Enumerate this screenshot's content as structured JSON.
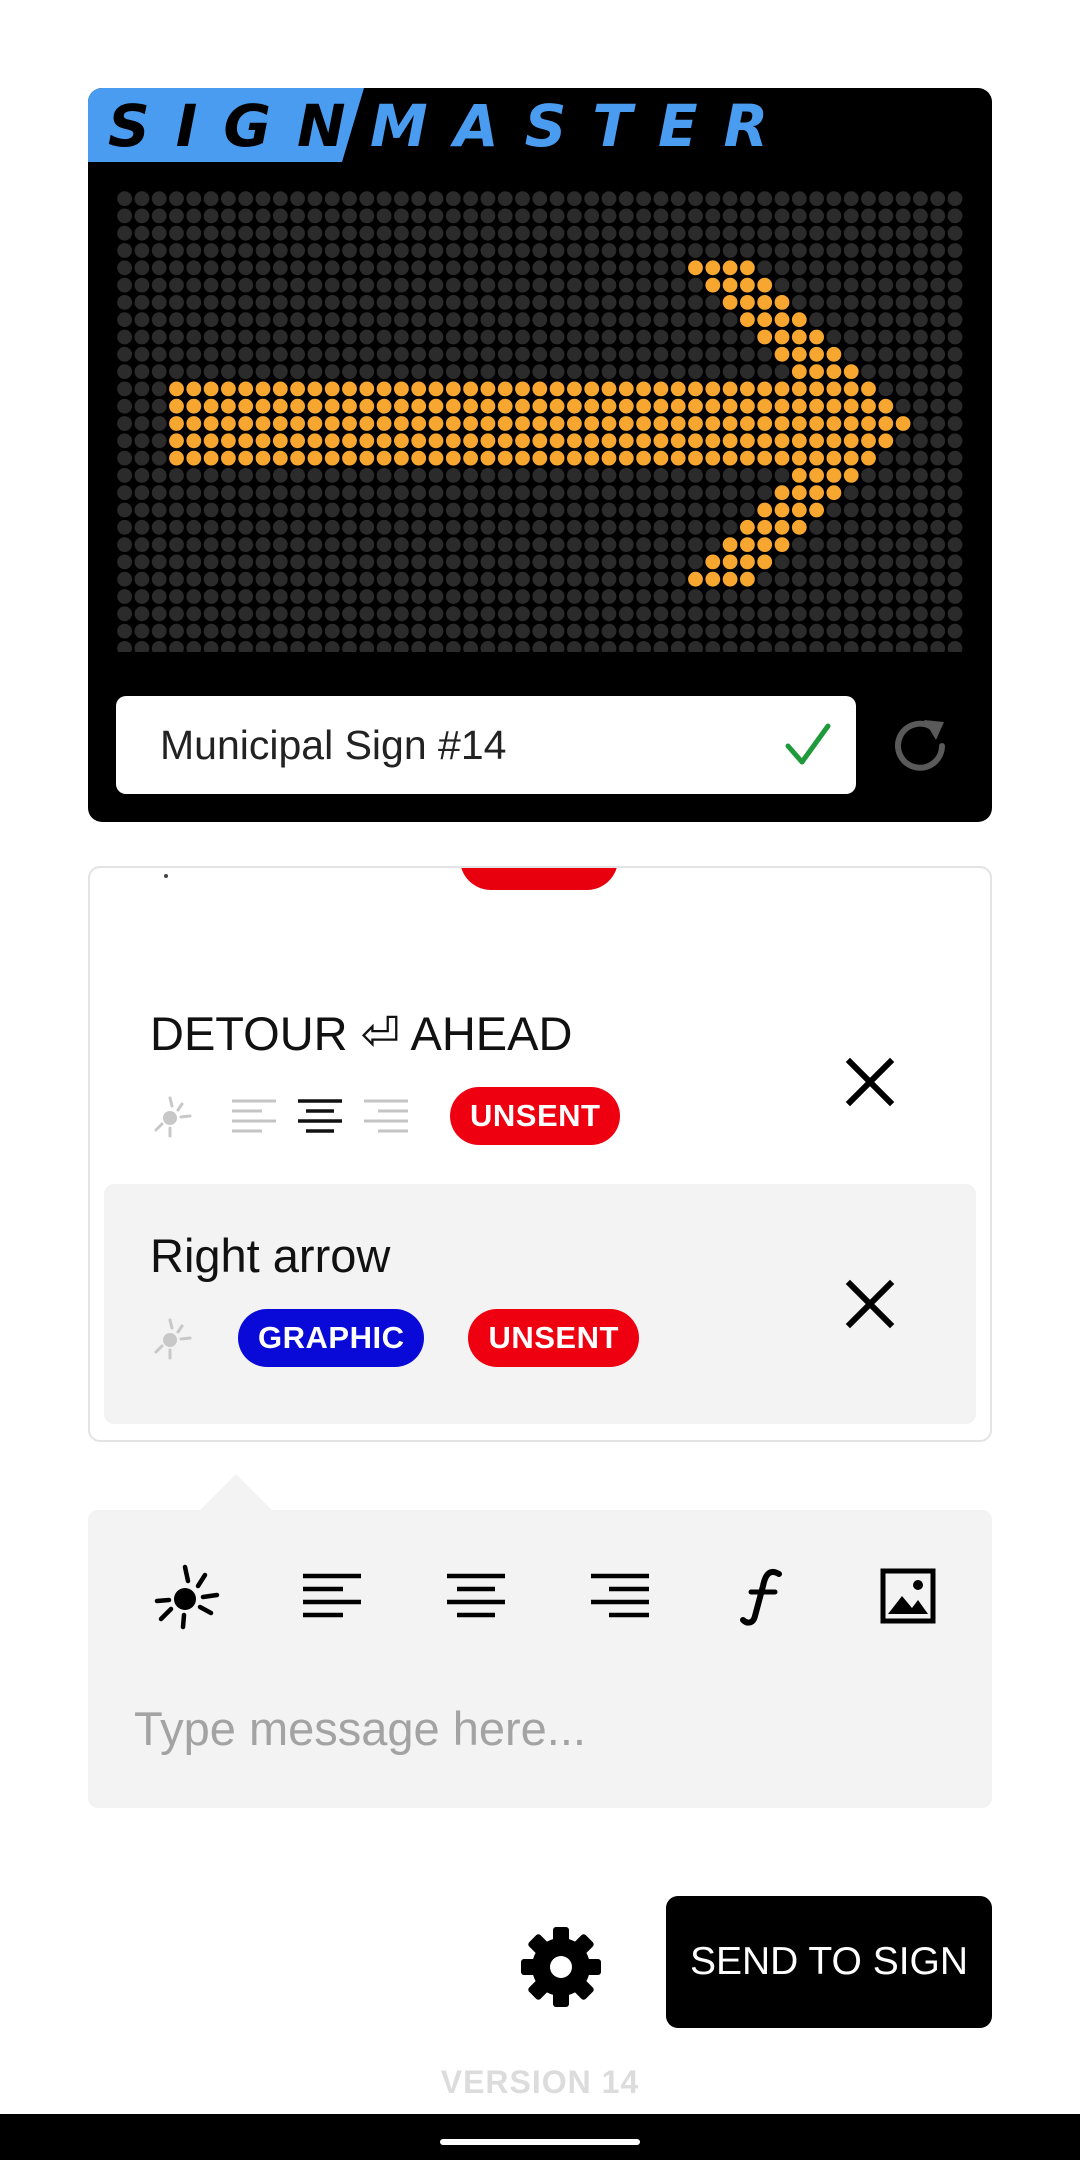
{
  "app": {
    "brand_left": "SIGN",
    "brand_right": "MASTER",
    "brand_accent_color": "#4a9cf0",
    "version_label": "VERSION 14"
  },
  "sign": {
    "name_value": "Municipal Sign #14",
    "name_valid_icon": "check-icon",
    "refresh_icon": "refresh-icon",
    "led_on_color": "#f7a72f",
    "led_off_color": "#2b2b2b",
    "preview": "right-arrow"
  },
  "queue": {
    "items": [
      {
        "title": "DETOUR ⏎ AHEAD",
        "icons": [
          "brightness-icon",
          "align-left-icon",
          "align-center-icon",
          "align-right-icon"
        ],
        "active_alignment": "center",
        "status": "UNSENT",
        "selected": false
      },
      {
        "title": "Right arrow",
        "icons": [
          "brightness-icon"
        ],
        "type_badge": "GRAPHIC",
        "status": "UNSENT",
        "selected": true
      }
    ],
    "status_color": "#ee0010",
    "graphic_color": "#0a0ad8"
  },
  "composer": {
    "tools": [
      "brightness-icon",
      "align-left-icon",
      "align-center-icon",
      "align-right-icon",
      "font-icon",
      "image-icon"
    ],
    "input_placeholder": "Type message here...",
    "input_value": ""
  },
  "footer": {
    "settings_icon": "gear-icon",
    "send_label": "SEND TO SIGN"
  }
}
